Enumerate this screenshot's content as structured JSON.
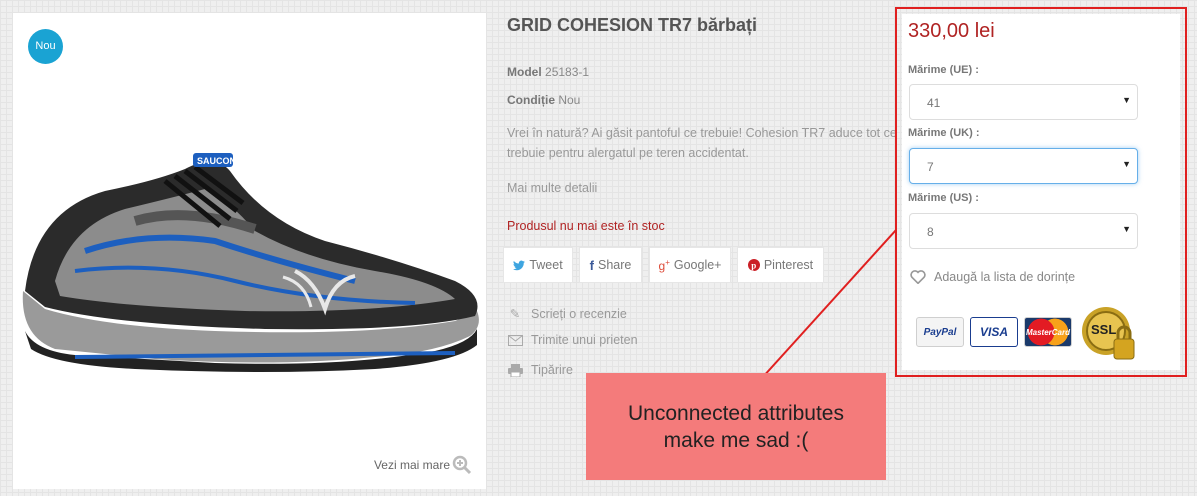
{
  "product": {
    "badge": "Nou",
    "title": "GRID COHESION TR7 bărbați",
    "model_label": "Model",
    "model_value": "25183-1",
    "condition_label": "Condiție",
    "condition_value": "Nou",
    "description_line1": "Vrei în natură? Ai găsit pantoful ce trebuie! Cohesion TR7 aduce tot ce",
    "description_line2": "trebuie pentru alergatul pe teren accidentat.",
    "more_details": "Mai multe detalii",
    "stock_status": "Produsul nu mai este în stoc",
    "view_larger": "Vezi mai mare",
    "shoe_logo_text": "SAUCONY"
  },
  "share": {
    "tweet": "Tweet",
    "share": "Share",
    "googleplus": "Google+",
    "pinterest": "Pinterest"
  },
  "actions": {
    "review": "Scrieți o recenzie",
    "send_friend": "Trimite unui prieten",
    "print": "Tipărire"
  },
  "buy_box": {
    "price": "330,00 lei",
    "size_eu_label": "Mărime (UE) :",
    "size_eu_value": "41",
    "size_uk_label": "Mărime (UK) :",
    "size_uk_value": "7",
    "size_us_label": "Mărime (US) :",
    "size_us_value": "8",
    "wishlist": "Adaugă la lista de dorințe",
    "payment_logos": {
      "paypal": "PayPal",
      "visa": "VISA",
      "mastercard": "MasterCard",
      "ssl": "SSL"
    }
  },
  "annotation": {
    "line1": "Unconnected attributes",
    "line2": "make me sad :("
  },
  "colors": {
    "accent_red": "#b02323",
    "badge_blue": "#1aa3d3",
    "annotation_bg": "#f47b7b",
    "annotation_border": "#e02020"
  }
}
